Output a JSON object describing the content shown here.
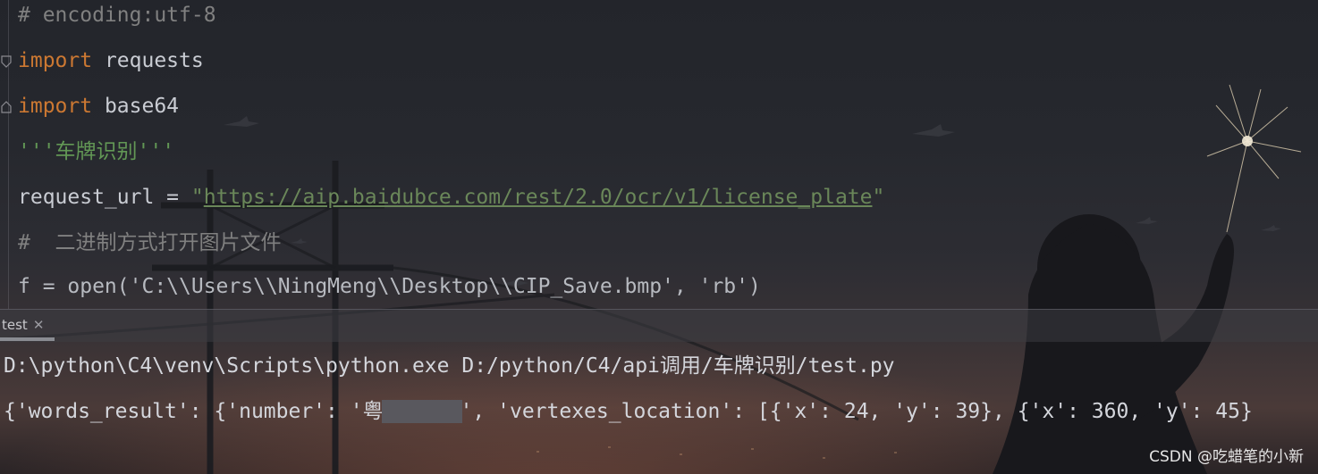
{
  "editor": {
    "line1": "# encoding:utf-8",
    "line2_kw": "import",
    "line2_rest": " requests",
    "line3_kw": "import",
    "line3_rest": " base64",
    "line4": "'''车牌识别'''",
    "line5_pre": "request_url = ",
    "line5_q1": "\"",
    "line5_url": "https://aip.baidubce.com/rest/2.0/ocr/v1/license_plate",
    "line5_q2": "\"",
    "line6": "#  二进制方式打开图片文件",
    "line7_partial": "f = open('C:\\\\Users\\\\NingMeng\\\\Desktop\\\\CIP_Save.bmp', 'rb')"
  },
  "run_panel": {
    "tab_label": "test",
    "console_line1": "D:\\python\\C4\\venv\\Scripts\\python.exe D:/python/C4/api调用/车牌识别/test.py",
    "console_line2_pre": "{'words_result': {'number': '粤",
    "console_line2_post": "', 'vertexes_location': [{'x': 24, 'y': 39}, {'x': 360, 'y': 45}"
  },
  "watermark": "CSDN @吃蜡笔的小新",
  "colors": {
    "keyword": "#cc7832",
    "comment": "#808080",
    "docstring": "#629755",
    "string": "#6a8759"
  }
}
